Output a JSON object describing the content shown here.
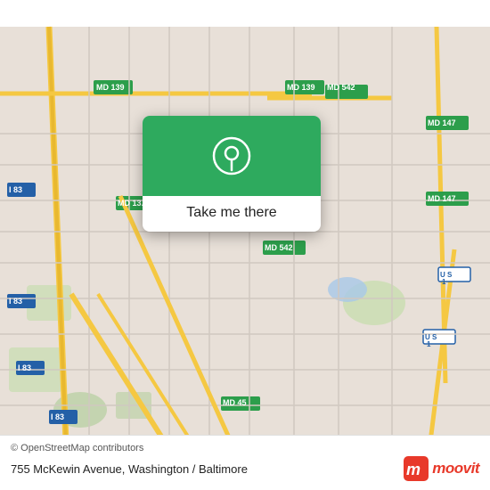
{
  "map": {
    "alt": "Map of Baltimore area showing 755 McKewin Avenue"
  },
  "popup": {
    "button_label": "Take me there"
  },
  "bottom_bar": {
    "copyright": "© OpenStreetMap contributors",
    "address": "755 McKewin Avenue, Washington / Baltimore",
    "moovit_label": "moovit"
  }
}
